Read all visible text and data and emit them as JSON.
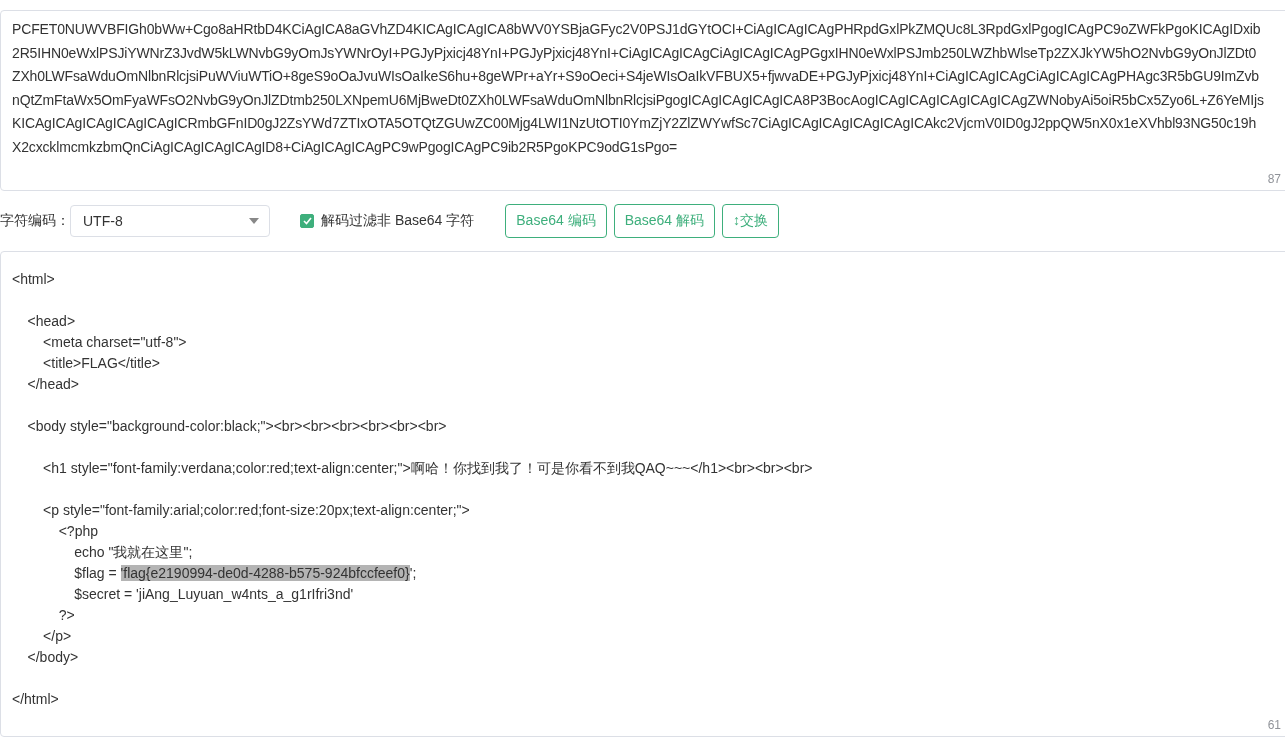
{
  "encoded": {
    "lines": [
      "PCFET0NUWVBFIGh0bWw+Cgo8aHRtbD4KCiAgICA8aGVhZD4KICAgICAgICA8bWV0YSBjaGFyc2V0PSJ1dGYtOCI+CiAgICAgICAgPHRpdGxlPkZMQUc8L3RpdGxlPgogICAgPC9oZWFkPgoKICAgIDxib",
      "2R5IHN0eWxlPSJiYWNrZ3JvdW5kLWNvbG9yOmJsYWNrOyI+PGJyPjxicj48YnI+PGJyPjxicj48YnI+CiAgICAgICAgCiAgICAgICAgPGgxIHN0eWxlPSJmb250LWZhbWlseTp2ZXJkYW5hO2NvbG9yOnJlZDt0",
      "ZXh0LWFsaWduOmNlbnRlcjsiPuWViuWTiO+8geS9oOaJvuWIsOaIkeS6hu+8geWPr+aYr+S9oOeci+S4jeWIsOaIkVFBUX5+fjwvaDE+PGJyPjxicj48YnI+CiAgICAgICAgCiAgICAgICAgPHAgc3R5bGU9ImZvb",
      "nQtZmFtaWx5OmFyaWFsO2NvbG9yOnJlZDtmb250LXNpemU6MjBweDt0ZXh0LWFsaWduOmNlbnRlcjsiPgogICAgICAgICAgICA8P3BocAogICAgICAgICAgICAgICAgZWNobyAi5oiR5bCx5Zyo6L+Z6YeMIjs",
      "KICAgICAgICAgICAgICAgICRmbGFnID0gJ2ZsYWd7ZTIxOTA5OTQtZGUwZC00Mjg4LWI1NzUtOTI0YmZjY2ZlZWYwfSc7CiAgICAgICAgICAgICAgICAkc2VjcmV0ID0gJ2ppQW5nX0x1eXVhbl93NG50c19h",
      "X2cxcklmcmkzbmQnCiAgICAgICAgICAgID8+CiAgICAgICAgPC9wPgogICAgPC9ib2R5PgoKPC9odG1sPgo="
    ],
    "count": "87"
  },
  "toolbar": {
    "charset_label": "字符编码：",
    "charset": "UTF-8",
    "filter": {
      "label": "解码过滤非 Base64 字符",
      "checked": true
    },
    "buttons": [
      "Base64 编码",
      "Base64 解码",
      "↕交换"
    ]
  },
  "decoded": {
    "count": "61",
    "lines": [
      {
        "segments": [
          {
            "text": "<html>",
            "highlight": false
          }
        ]
      },
      {
        "kind": "blank"
      },
      {
        "segments": [
          {
            "text": "    <head>",
            "highlight": false
          }
        ]
      },
      {
        "segments": [
          {
            "text": "        <meta charset=\"utf-8\">",
            "highlight": false
          }
        ]
      },
      {
        "segments": [
          {
            "text": "        <title>FLAG</title>",
            "highlight": false
          }
        ]
      },
      {
        "segments": [
          {
            "text": "    </head>",
            "highlight": false
          }
        ]
      },
      {
        "kind": "blank"
      },
      {
        "segments": [
          {
            "text": "    <body style=\"background-color:black;\"><br><br><br><br><br><br>",
            "highlight": false
          }
        ]
      },
      {
        "kind": "blank"
      },
      {
        "segments": [
          {
            "text": "        <h1 style=\"font-family:verdana;color:red;text-align:center;\">啊哈！你找到我了！可是你看不到我QAQ~~~</h1><br><br><br>",
            "highlight": false
          }
        ]
      },
      {
        "kind": "blank"
      },
      {
        "segments": [
          {
            "text": "        <p style=\"font-family:arial;color:red;font-size:20px;text-align:center;\">",
            "highlight": false
          }
        ]
      },
      {
        "segments": [
          {
            "text": "            <?php",
            "highlight": false
          }
        ]
      },
      {
        "segments": [
          {
            "text": "                echo \"我就在这里\";",
            "highlight": false
          }
        ]
      },
      {
        "segments": [
          {
            "text": "                $flag = ",
            "highlight": false
          },
          {
            "text": "'flag{e2190994-de0d-4288-b575-924bfccfeef0}",
            "highlight": true
          },
          {
            "text": "';",
            "highlight": false
          }
        ]
      },
      {
        "segments": [
          {
            "text": "                $secret = 'jiAng_Luyuan_w4nts_a_g1rIfri3nd'",
            "highlight": false
          }
        ]
      },
      {
        "segments": [
          {
            "text": "            ?>",
            "highlight": false
          }
        ]
      },
      {
        "segments": [
          {
            "text": "        </p>",
            "highlight": false
          }
        ]
      },
      {
        "segments": [
          {
            "text": "    </body>",
            "highlight": false
          }
        ]
      },
      {
        "kind": "blank"
      },
      {
        "segments": [
          {
            "text": "</html>",
            "highlight": false
          }
        ]
      }
    ]
  }
}
